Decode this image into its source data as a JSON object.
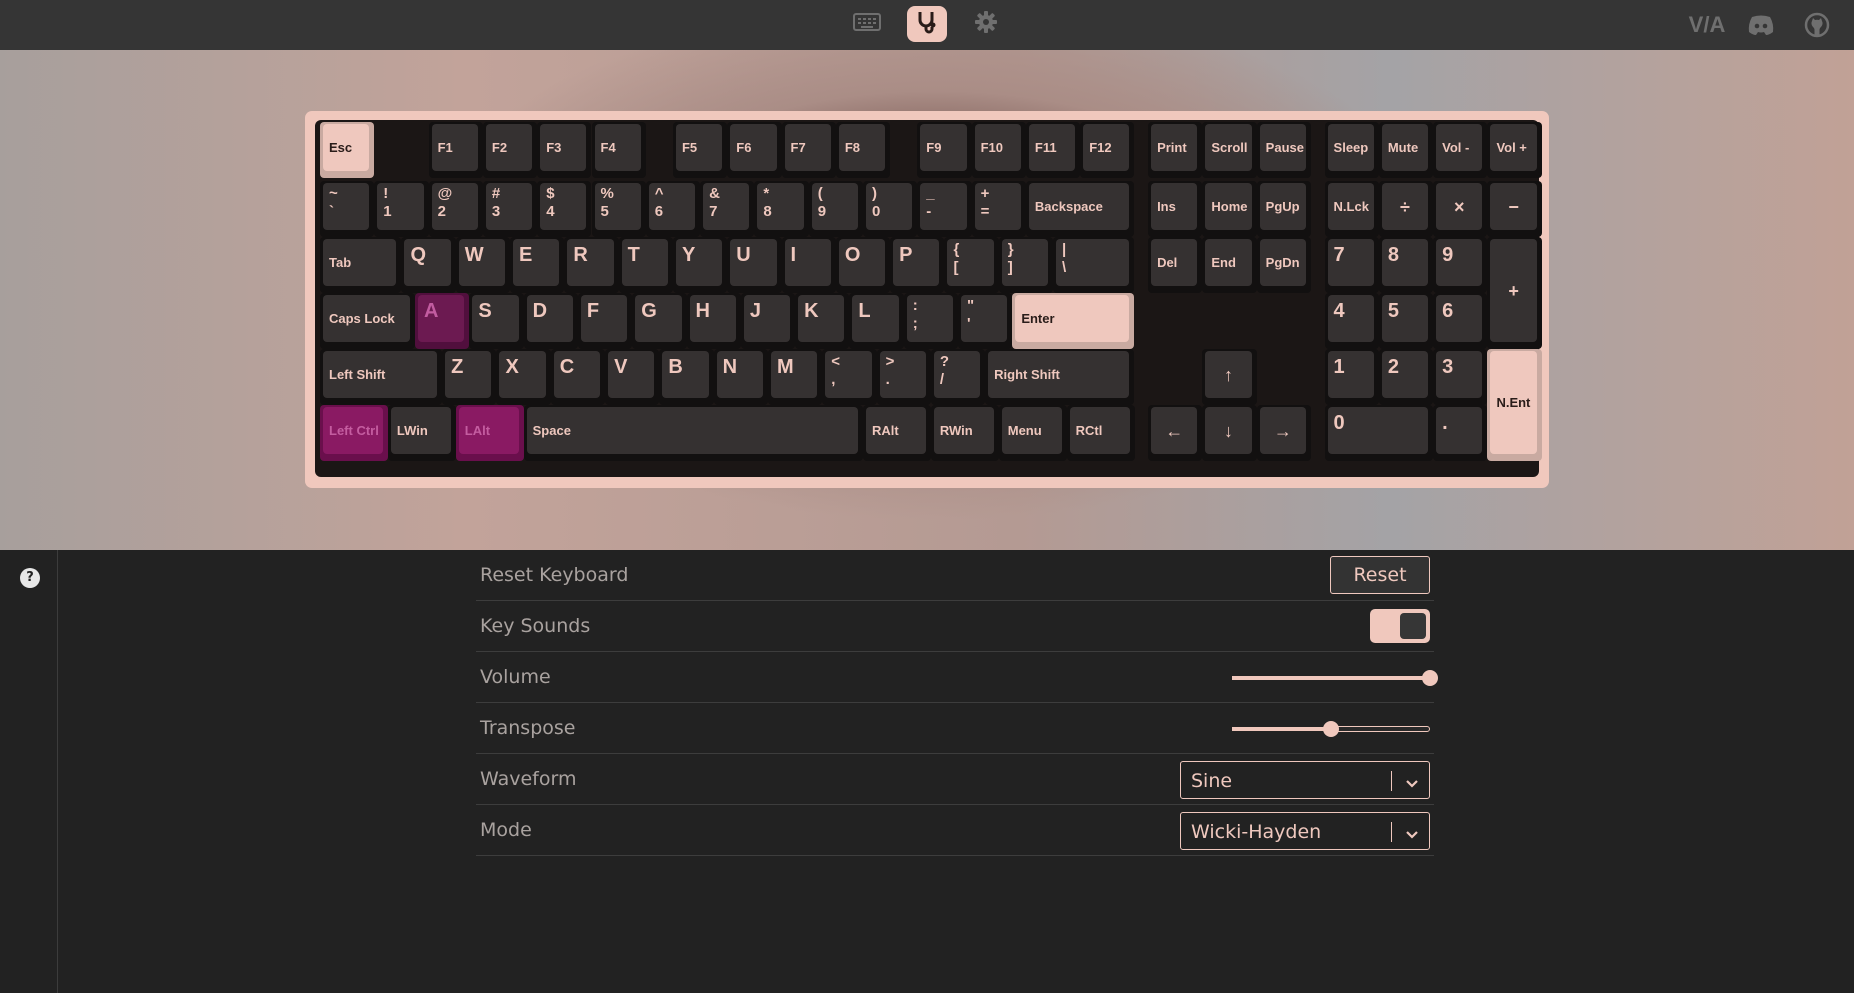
{
  "nav": {
    "items": [
      {
        "name": "keyboard-icon"
      },
      {
        "name": "stethoscope-icon",
        "active": true
      },
      {
        "name": "gear-icon"
      }
    ],
    "links": [
      {
        "name": "via-logo",
        "text": "V/A"
      },
      {
        "name": "discord-icon"
      },
      {
        "name": "github-icon"
      }
    ]
  },
  "keyboard": {
    "rows": [
      [
        {
          "l": "Esc",
          "x": 0,
          "w": 1,
          "s": "light"
        },
        {
          "l": "F1",
          "x": 2,
          "w": 1
        },
        {
          "l": "F2",
          "x": 3,
          "w": 1
        },
        {
          "l": "F3",
          "x": 4,
          "w": 1
        },
        {
          "l": "F4",
          "x": 5,
          "w": 1
        },
        {
          "l": "F5",
          "x": 6.5,
          "w": 1
        },
        {
          "l": "F6",
          "x": 7.5,
          "w": 1
        },
        {
          "l": "F7",
          "x": 8.5,
          "w": 1
        },
        {
          "l": "F8",
          "x": 9.5,
          "w": 1
        },
        {
          "l": "F9",
          "x": 11,
          "w": 1
        },
        {
          "l": "F10",
          "x": 12,
          "w": 1
        },
        {
          "l": "F11",
          "x": 13,
          "w": 1
        },
        {
          "l": "F12",
          "x": 14,
          "w": 1
        },
        {
          "l": "Print",
          "x": 15.25,
          "w": 1
        },
        {
          "l": "Scroll",
          "x": 16.25,
          "w": 1
        },
        {
          "l": "Pause",
          "x": 17.25,
          "w": 1
        },
        {
          "l": "Sleep",
          "x": 18.5,
          "w": 1
        },
        {
          "l": "Mute",
          "x": 19.5,
          "w": 1
        },
        {
          "l": "Vol -",
          "x": 20.5,
          "w": 1
        },
        {
          "l": "Vol +",
          "x": 21.5,
          "w": 1
        }
      ],
      [
        {
          "t": "~",
          "b": "`",
          "x": 0,
          "w": 1
        },
        {
          "t": "!",
          "b": "1",
          "x": 1,
          "w": 1
        },
        {
          "t": "@",
          "b": "2",
          "x": 2,
          "w": 1
        },
        {
          "t": "#",
          "b": "3",
          "x": 3,
          "w": 1
        },
        {
          "t": "$",
          "b": "4",
          "x": 4,
          "w": 1
        },
        {
          "t": "%",
          "b": "5",
          "x": 5,
          "w": 1
        },
        {
          "t": "^",
          "b": "6",
          "x": 6,
          "w": 1
        },
        {
          "t": "&",
          "b": "7",
          "x": 7,
          "w": 1
        },
        {
          "t": "*",
          "b": "8",
          "x": 8,
          "w": 1
        },
        {
          "t": "(",
          "b": "9",
          "x": 9,
          "w": 1
        },
        {
          "t": ")",
          "b": "0",
          "x": 10,
          "w": 1
        },
        {
          "t": "_",
          "b": "-",
          "x": 11,
          "w": 1
        },
        {
          "t": "+",
          "b": "=",
          "x": 12,
          "w": 1
        },
        {
          "l": "Backspace",
          "x": 13,
          "w": 2
        },
        {
          "l": "Ins",
          "x": 15.25,
          "w": 1
        },
        {
          "l": "Home",
          "x": 16.25,
          "w": 1
        },
        {
          "l": "PgUp",
          "x": 17.25,
          "w": 1
        },
        {
          "l": "N.Lck",
          "x": 18.5,
          "w": 1
        },
        {
          "l": "÷",
          "x": 19.5,
          "w": 1,
          "c": true
        },
        {
          "l": "×",
          "x": 20.5,
          "w": 1,
          "c": true
        },
        {
          "l": "−",
          "x": 21.5,
          "w": 1,
          "c": true
        }
      ],
      [
        {
          "l": "Tab",
          "x": 0,
          "w": 1.5
        },
        {
          "l": "Q",
          "x": 1.5,
          "w": 1,
          "big": true
        },
        {
          "l": "W",
          "x": 2.5,
          "w": 1,
          "big": true
        },
        {
          "l": "E",
          "x": 3.5,
          "w": 1,
          "big": true
        },
        {
          "l": "R",
          "x": 4.5,
          "w": 1,
          "big": true
        },
        {
          "l": "T",
          "x": 5.5,
          "w": 1,
          "big": true
        },
        {
          "l": "Y",
          "x": 6.5,
          "w": 1,
          "big": true
        },
        {
          "l": "U",
          "x": 7.5,
          "w": 1,
          "big": true
        },
        {
          "l": "I",
          "x": 8.5,
          "w": 1,
          "big": true
        },
        {
          "l": "O",
          "x": 9.5,
          "w": 1,
          "big": true
        },
        {
          "l": "P",
          "x": 10.5,
          "w": 1,
          "big": true
        },
        {
          "t": "{",
          "b": "[",
          "x": 11.5,
          "w": 1
        },
        {
          "t": "}",
          "b": "]",
          "x": 12.5,
          "w": 1
        },
        {
          "t": "|",
          "b": "\\",
          "x": 13.5,
          "w": 1.5
        },
        {
          "l": "Del",
          "x": 15.25,
          "w": 1
        },
        {
          "l": "End",
          "x": 16.25,
          "w": 1
        },
        {
          "l": "PgDn",
          "x": 17.25,
          "w": 1
        },
        {
          "l": "7",
          "x": 18.5,
          "w": 1,
          "big": true
        },
        {
          "l": "8",
          "x": 19.5,
          "w": 1,
          "big": true
        },
        {
          "l": "9",
          "x": 20.5,
          "w": 1,
          "big": true
        },
        {
          "l": "+",
          "x": 21.5,
          "w": 1,
          "h": 2,
          "c": true
        }
      ],
      [
        {
          "l": "Caps Lock",
          "x": 0,
          "w": 1.75
        },
        {
          "l": "A",
          "x": 1.75,
          "w": 1,
          "big": true,
          "s": "hl"
        },
        {
          "l": "S",
          "x": 2.75,
          "w": 1,
          "big": true
        },
        {
          "l": "D",
          "x": 3.75,
          "w": 1,
          "big": true
        },
        {
          "l": "F",
          "x": 4.75,
          "w": 1,
          "big": true
        },
        {
          "l": "G",
          "x": 5.75,
          "w": 1,
          "big": true
        },
        {
          "l": "H",
          "x": 6.75,
          "w": 1,
          "big": true
        },
        {
          "l": "J",
          "x": 7.75,
          "w": 1,
          "big": true
        },
        {
          "l": "K",
          "x": 8.75,
          "w": 1,
          "big": true
        },
        {
          "l": "L",
          "x": 9.75,
          "w": 1,
          "big": true
        },
        {
          "t": ":",
          "b": ";",
          "x": 10.75,
          "w": 1
        },
        {
          "t": "\"",
          "b": "'",
          "x": 11.75,
          "w": 1
        },
        {
          "l": "Enter",
          "x": 12.75,
          "w": 2.25,
          "s": "light"
        },
        {
          "l": "4",
          "x": 18.5,
          "w": 1,
          "big": true
        },
        {
          "l": "5",
          "x": 19.5,
          "w": 1,
          "big": true
        },
        {
          "l": "6",
          "x": 20.5,
          "w": 1,
          "big": true
        }
      ],
      [
        {
          "l": "Left Shift",
          "x": 0,
          "w": 2.25
        },
        {
          "l": "Z",
          "x": 2.25,
          "w": 1,
          "big": true
        },
        {
          "l": "X",
          "x": 3.25,
          "w": 1,
          "big": true
        },
        {
          "l": "C",
          "x": 4.25,
          "w": 1,
          "big": true
        },
        {
          "l": "V",
          "x": 5.25,
          "w": 1,
          "big": true
        },
        {
          "l": "B",
          "x": 6.25,
          "w": 1,
          "big": true
        },
        {
          "l": "N",
          "x": 7.25,
          "w": 1,
          "big": true
        },
        {
          "l": "M",
          "x": 8.25,
          "w": 1,
          "big": true
        },
        {
          "t": "<",
          "b": ",",
          "x": 9.25,
          "w": 1
        },
        {
          "t": ">",
          "b": ".",
          "x": 10.25,
          "w": 1
        },
        {
          "t": "?",
          "b": "/",
          "x": 11.25,
          "w": 1
        },
        {
          "l": "Right Shift",
          "x": 12.25,
          "w": 2.75
        },
        {
          "l": "↑",
          "x": 16.25,
          "w": 1,
          "c": true
        },
        {
          "l": "1",
          "x": 18.5,
          "w": 1,
          "big": true
        },
        {
          "l": "2",
          "x": 19.5,
          "w": 1,
          "big": true
        },
        {
          "l": "3",
          "x": 20.5,
          "w": 1,
          "big": true
        },
        {
          "l": "N.Ent",
          "x": 21.5,
          "w": 1,
          "h": 2,
          "s": "light",
          "mid": true
        }
      ],
      [
        {
          "l": "Left Ctrl",
          "x": 0,
          "w": 1.25,
          "s": "pressed"
        },
        {
          "l": "LWin",
          "x": 1.25,
          "w": 1.25
        },
        {
          "l": "LAlt",
          "x": 2.5,
          "w": 1.25,
          "s": "pressed"
        },
        {
          "l": "Space",
          "x": 3.75,
          "w": 6.25
        },
        {
          "l": "RAlt",
          "x": 10,
          "w": 1.25
        },
        {
          "l": "RWin",
          "x": 11.25,
          "w": 1.25
        },
        {
          "l": "Menu",
          "x": 12.5,
          "w": 1.25
        },
        {
          "l": "RCtl",
          "x": 13.75,
          "w": 1.25
        },
        {
          "l": "←",
          "x": 15.25,
          "w": 1,
          "c": true
        },
        {
          "l": "↓",
          "x": 16.25,
          "w": 1,
          "c": true
        },
        {
          "l": "→",
          "x": 17.25,
          "w": 1,
          "c": true
        },
        {
          "l": "0",
          "x": 18.5,
          "w": 2,
          "big": true
        },
        {
          "l": ".",
          "x": 20.5,
          "w": 1,
          "big": true
        }
      ]
    ]
  },
  "settings": {
    "help_icon": "?",
    "reset_keyboard": {
      "label": "Reset Keyboard",
      "button": "Reset"
    },
    "key_sounds": {
      "label": "Key Sounds",
      "enabled": true
    },
    "volume": {
      "label": "Volume",
      "value": 1.0
    },
    "transpose": {
      "label": "Transpose",
      "value": 0.5
    },
    "waveform": {
      "label": "Waveform",
      "value": "Sine"
    },
    "mode": {
      "label": "Mode",
      "value": "Wicki-Hayden"
    }
  }
}
